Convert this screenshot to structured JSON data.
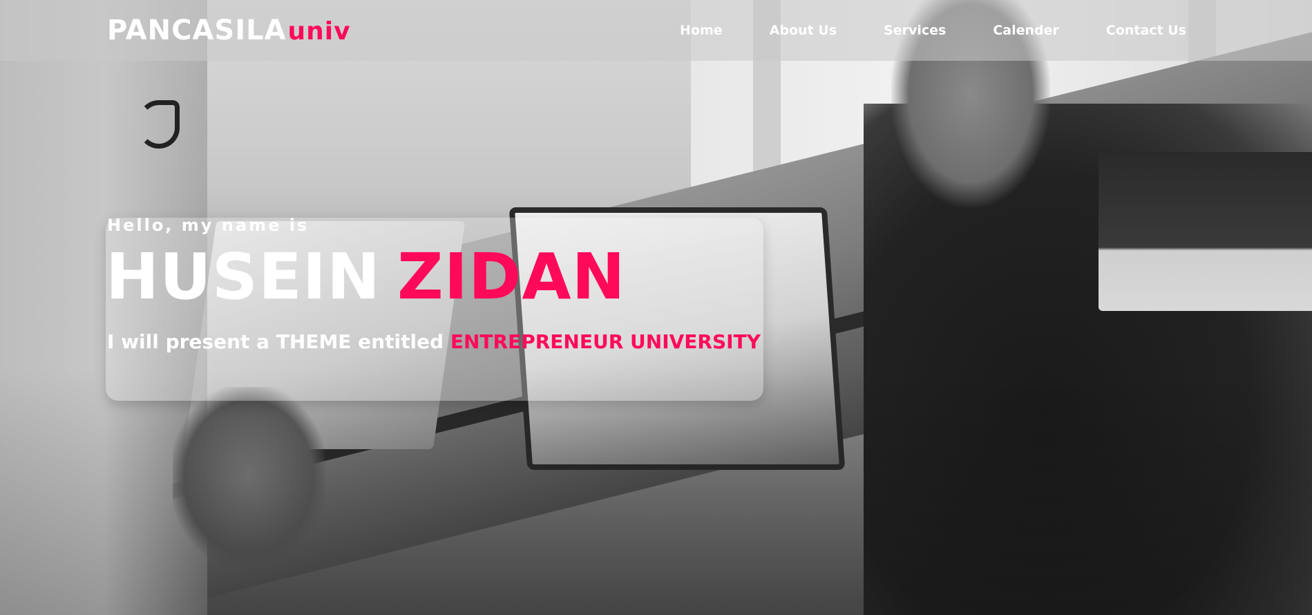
{
  "brand": {
    "primary": "PANCASILA",
    "accent": "univ"
  },
  "nav": {
    "items": [
      {
        "label": "Home"
      },
      {
        "label": "About Us"
      },
      {
        "label": "Services"
      },
      {
        "label": "Calender"
      },
      {
        "label": "Contact Us"
      }
    ]
  },
  "hero": {
    "greeting": "Hello, my name is",
    "first_name": "HUSEIN",
    "last_name": "ZIDAN",
    "tagline_prefix": "I will present a THEME entitled",
    "tagline_highlight": "ENTREPRENEUR UNIVERSITY"
  },
  "colors": {
    "accent": "#ff0a5a",
    "text": "#ffffff"
  }
}
